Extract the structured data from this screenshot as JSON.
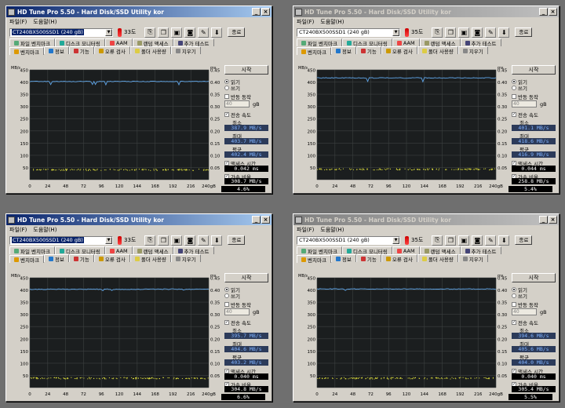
{
  "title": "HD Tune Pro 5.50 - Hard Disk/SSD Utility kor",
  "menu": [
    "파일(F)",
    "도움말(H)"
  ],
  "exit_label": "종료",
  "tabs_row1": [
    "파일 벤치마크",
    "디스크 모니터링",
    "AAM",
    "랜덤 액세스",
    "추가 테스트"
  ],
  "tabs_row2": [
    "벤치마크",
    "정보",
    "기능",
    "오류 검사",
    "폴더 사용량",
    "지우기"
  ],
  "side_labels": {
    "start": "시작",
    "read": "읽기",
    "write": "쓰기",
    "repeat": "반동 동작",
    "unit_gb": "gB",
    "transfer": "전송 속도",
    "min": "최소",
    "max": "최대",
    "avg": "평균",
    "access": "액세스 시간",
    "burst": "가속 비율",
    "cpu": "CPU 사용량"
  },
  "axis": {
    "y_left_unit": "MB/s",
    "y_right_unit": "ms",
    "y_left_ticks": [
      "450",
      "400",
      "350",
      "300",
      "250",
      "200",
      "150",
      "100",
      "50"
    ],
    "y_right_ticks": [
      "0.45",
      "0.40",
      "0.35",
      "0.30",
      "0.25",
      "0.20",
      "0.15",
      "0.10",
      "0.05"
    ],
    "x_ticks": [
      "0",
      "24",
      "48",
      "72",
      "96",
      "120",
      "144",
      "168",
      "192",
      "216",
      "240gB"
    ]
  },
  "colors": {
    "title_active": "#0a246a",
    "chart_bg": "#1b1e1f",
    "grid": "#3c4040",
    "read_line": "#5fa5e8",
    "access_dots": "#e6e63c",
    "value_box": "#2c3b5a"
  },
  "windows": [
    {
      "state": "active",
      "drive": "CT240BX500SSD1 (240 gB)",
      "temp": "33도",
      "repeat_value": "40",
      "min": "387.9 MB/s",
      "max": "403.7 MB/s",
      "avg": "402.4 MB/s",
      "access": "0.042 ms",
      "burst": "308.7 MB/s",
      "cpu": "4.6%"
    },
    {
      "state": "inactive",
      "drive": "CT240BX500SSD1 (240 gB)",
      "temp": "35도",
      "repeat_value": "40",
      "min": "401.1 MB/s",
      "max": "418.6 MB/s",
      "avg": "416.9 MB/s",
      "access": "0.044 ms",
      "burst": "258.8 MB/s",
      "cpu": "5.4%"
    },
    {
      "state": "active",
      "drive": "CT240BX500SSD1 (240 gB)",
      "temp": "33도",
      "repeat_value": "40",
      "min": "395.7 MB/s",
      "max": "404.6 MB/s",
      "avg": "403.2 MB/s",
      "access": "0.040 ms",
      "burst": "304.8 MB/s",
      "cpu": "6.6%"
    },
    {
      "state": "inactive",
      "drive": "CT240BX500SSD1 (240 gB)",
      "temp": "35도",
      "repeat_value": "40",
      "min": "394.6 MB/s",
      "max": "405.6 MB/s",
      "avg": "404.0 MB/s",
      "access": "0.040 ms",
      "burst": "305.4 MB/s",
      "cpu": "5.5%"
    }
  ]
}
